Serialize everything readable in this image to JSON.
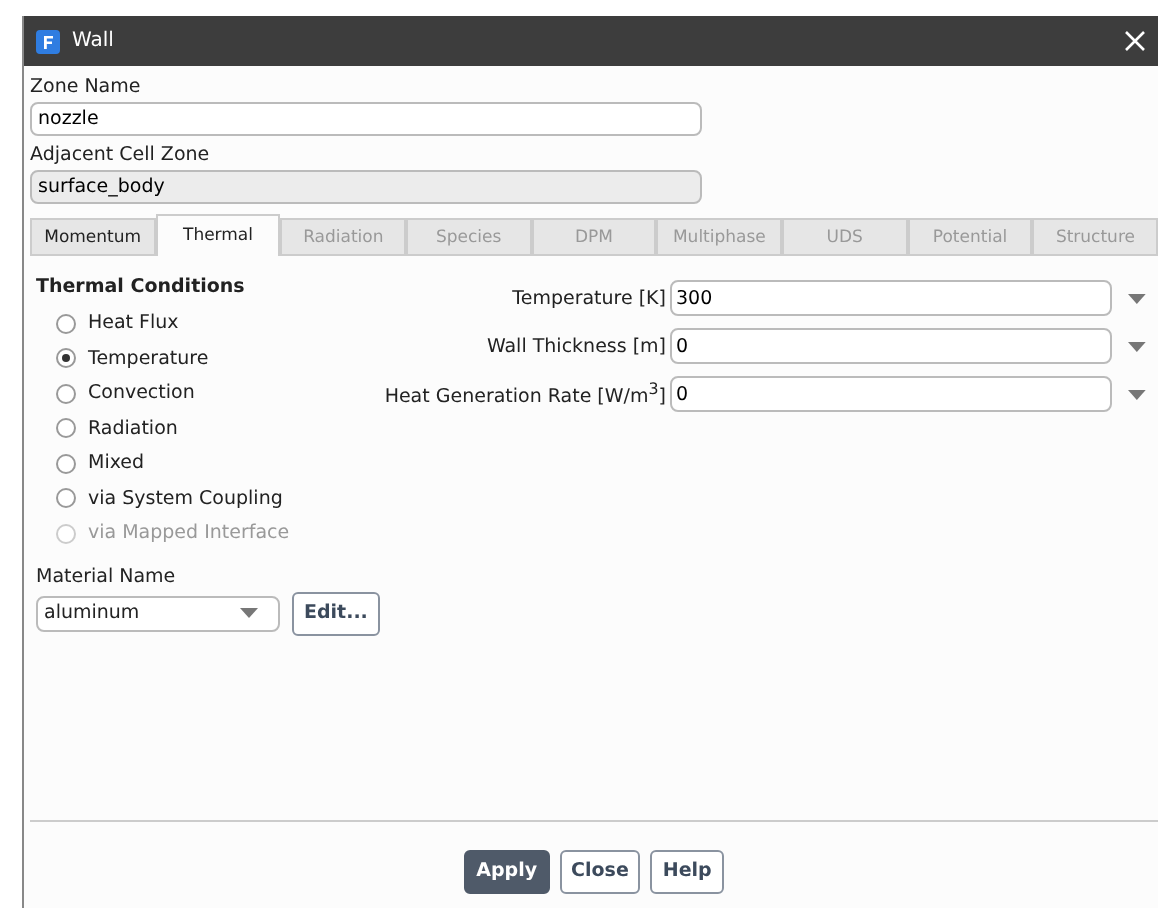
{
  "window": {
    "title": "Wall"
  },
  "zone_name": {
    "label": "Zone Name",
    "value": "nozzle"
  },
  "adjacent_cell_zone": {
    "label": "Adjacent Cell Zone",
    "value": "surface_body",
    "disabled": true
  },
  "tabs": [
    {
      "label": "Momentum",
      "selected": false,
      "disabled": false
    },
    {
      "label": "Thermal",
      "selected": true,
      "disabled": false
    },
    {
      "label": "Radiation",
      "selected": false,
      "disabled": true
    },
    {
      "label": "Species",
      "selected": false,
      "disabled": true
    },
    {
      "label": "DPM",
      "selected": false,
      "disabled": true
    },
    {
      "label": "Multiphase",
      "selected": false,
      "disabled": true
    },
    {
      "label": "UDS",
      "selected": false,
      "disabled": true
    },
    {
      "label": "Potential",
      "selected": false,
      "disabled": true
    },
    {
      "label": "Structure",
      "selected": false,
      "disabled": true
    }
  ],
  "thermal_conditions": {
    "title": "Thermal Conditions",
    "options": [
      {
        "label": "Heat Flux",
        "selected": false,
        "disabled": false
      },
      {
        "label": "Temperature",
        "selected": true,
        "disabled": false
      },
      {
        "label": "Convection",
        "selected": false,
        "disabled": false
      },
      {
        "label": "Radiation",
        "selected": false,
        "disabled": false
      },
      {
        "label": "Mixed",
        "selected": false,
        "disabled": false
      },
      {
        "label": "via System Coupling",
        "selected": false,
        "disabled": false
      },
      {
        "label": "via Mapped Interface",
        "selected": false,
        "disabled": true
      }
    ]
  },
  "parameters": [
    {
      "label": "Temperature [K]",
      "value": "300"
    },
    {
      "label": "Wall Thickness [m]",
      "value": "0"
    },
    {
      "label": "Heat Generation Rate [W/m$^{3}$]",
      "value": "0"
    }
  ],
  "material": {
    "label": "Material Name",
    "value": "aluminum",
    "edit_button": "Edit..."
  },
  "buttons": [
    {
      "label": "Apply",
      "primary": true
    },
    {
      "label": "Close",
      "primary": false
    },
    {
      "label": "Help",
      "primary": false
    }
  ]
}
